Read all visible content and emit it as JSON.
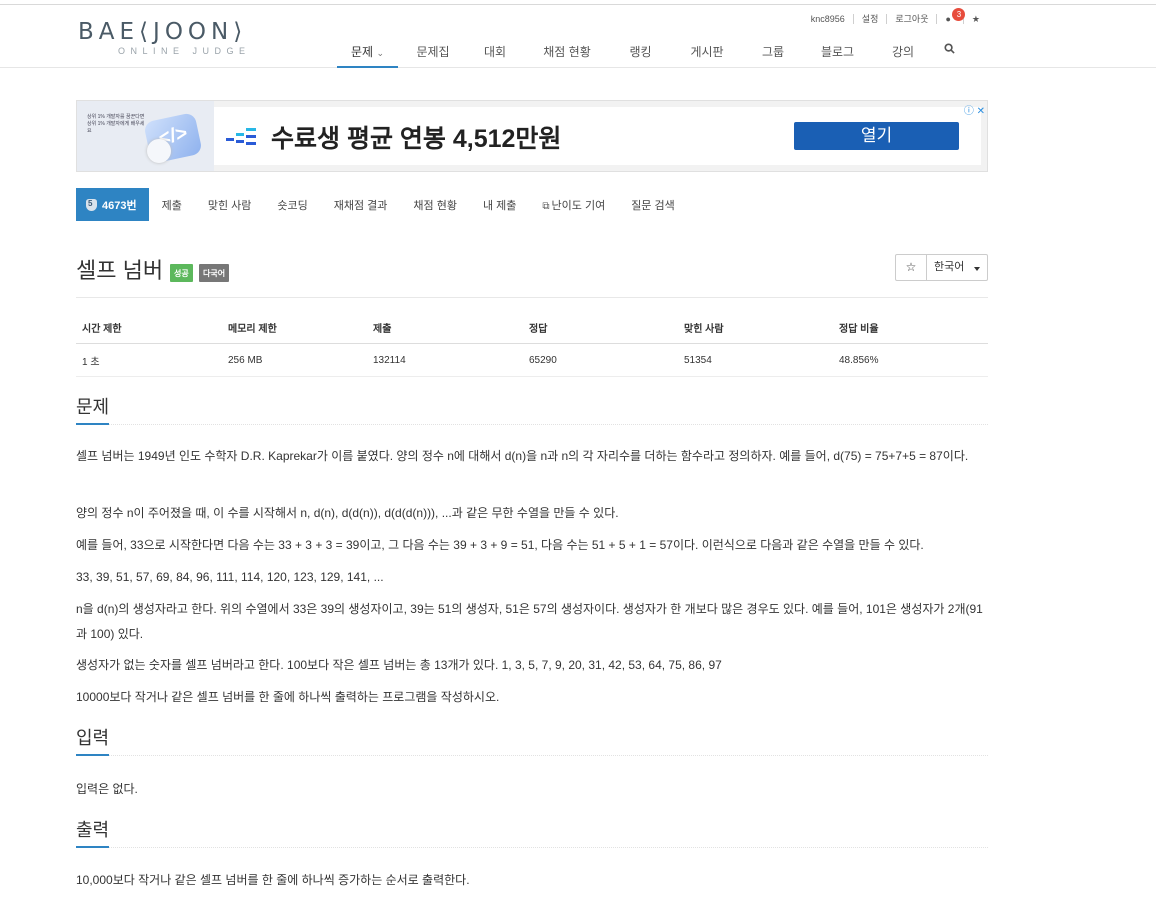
{
  "header": {
    "logo_text": "BAEKJOON",
    "logo_sub": "ONLINE JUDGE",
    "user_links": [
      "knc8956",
      "설정",
      "로그아웃"
    ],
    "notification_count": "3",
    "star": "★",
    "nav": [
      "문제",
      "문제집",
      "대회",
      "채점 현황",
      "랭킹",
      "게시판",
      "그룹",
      "블로그",
      "강의"
    ],
    "nav_active_caret": "⌄"
  },
  "ad": {
    "thumb_text": "상위 1% 개발자를 꿈꾼다면 상위 1% 개발자에게 배우세요",
    "headline": "수료생 평균 연봉 4,512만원",
    "button": "열기",
    "icons": "ⓘ ✕"
  },
  "subnav": {
    "problem_id": "4673번",
    "tier_label": "5",
    "links": [
      "제출",
      "맞힌 사람",
      "숏코딩",
      "재채점 결과",
      "채점 현황",
      "내 제출",
      "난이도 기여",
      "질문 검색"
    ]
  },
  "problem": {
    "title": "셀프 넘버",
    "label_success": "성공",
    "label_multilang": "다국어",
    "star_button": "☆",
    "language": "한국어"
  },
  "info_table": {
    "headers": [
      "시간 제한",
      "메모리 제한",
      "제출",
      "정답",
      "맞힌 사람",
      "정답 비율"
    ],
    "row": [
      "1 초",
      "256 MB",
      "132114",
      "65290",
      "51354",
      "48.856%"
    ]
  },
  "sections": {
    "problem_head": "문제",
    "problem_paras": [
      "셀프 넘버는 1949년 인도 수학자 D.R. Kaprekar가 이름 붙였다. 양의 정수 n에 대해서 d(n)을 n과 n의 각 자리수를 더하는 함수라고 정의하자. 예를 들어, d(75) = 75+7+5 = 87이다.",
      "양의 정수 n이 주어졌을 때, 이 수를 시작해서 n, d(n), d(d(n)), d(d(d(n))), ...과 같은 무한 수열을 만들 수 있다.",
      "예를 들어, 33으로 시작한다면 다음 수는 33 + 3 + 3 = 39이고, 그 다음 수는 39 + 3 + 9 = 51, 다음 수는 51 + 5 + 1 = 57이다. 이런식으로 다음과 같은 수열을 만들 수 있다.",
      "33, 39, 51, 57, 69, 84, 96, 111, 114, 120, 123, 129, 141, ...",
      "n을 d(n)의 생성자라고 한다. 위의 수열에서 33은 39의 생성자이고, 39는 51의 생성자, 51은 57의 생성자이다. 생성자가 한 개보다 많은 경우도 있다. 예를 들어, 101은 생성자가 2개(91과 100) 있다.",
      "생성자가 없는 숫자를 셀프 넘버라고 한다. 100보다 작은 셀프 넘버는 총 13개가 있다. 1, 3, 5, 7, 9, 20, 31, 42, 53, 64, 75, 86, 97",
      "10000보다 작거나 같은 셀프 넘버를 한 줄에 하나씩 출력하는 프로그램을 작성하시오."
    ],
    "input_head": "입력",
    "input_text": "입력은 없다.",
    "output_head": "출력",
    "output_text": "10,000보다 작거나 같은 셀프 넘버를 한 줄에 하나씩 증가하는 순서로 출력한다."
  }
}
